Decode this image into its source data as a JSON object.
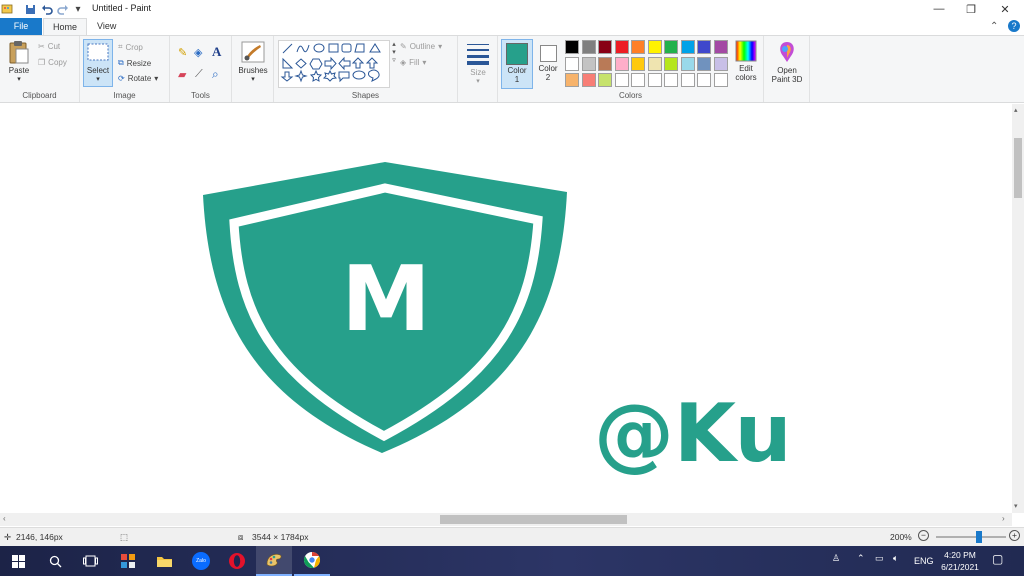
{
  "window": {
    "title": "Untitled - Paint",
    "controls": {
      "minimize": "—",
      "maximize": "❐",
      "close": "✕"
    }
  },
  "tabs": [
    {
      "label": "File"
    },
    {
      "label": "Home"
    },
    {
      "label": "View"
    }
  ],
  "ribbon": {
    "clipboard": {
      "label": "Clipboard",
      "paste": "Paste",
      "cut": "Cut",
      "copy": "Copy"
    },
    "image": {
      "label": "Image",
      "select": "Select",
      "crop": "Crop",
      "resize": "Resize",
      "rotate": "Rotate"
    },
    "tools": {
      "label": "Tools"
    },
    "brushes": {
      "label": "Brushes"
    },
    "shapes": {
      "label": "Shapes",
      "outline": "Outline",
      "fill": "Fill"
    },
    "size": {
      "label": "Size"
    },
    "colors": {
      "label": "Colors",
      "color1_label": "Color",
      "color1_num": "1",
      "color2_label": "Color",
      "color2_num": "2",
      "color1": "#26a08b",
      "color2": "#ffffff",
      "palette_row1": [
        "#000000",
        "#7f7f7f",
        "#880015",
        "#ed1c24",
        "#ff7f27",
        "#fff200",
        "#22b14c",
        "#00a2e8",
        "#3f48cc",
        "#a349a4"
      ],
      "palette_row2": [
        "#ffffff",
        "#c3c3c3",
        "#b97a57",
        "#ffaec9",
        "#ffc90e",
        "#efe4b0",
        "#b5e61d",
        "#99d9ea",
        "#7092be",
        "#c8bfe7"
      ],
      "palette_row3": [
        "#f7b36b",
        "#f77e76",
        "#c6e26c",
        "#ffffff",
        "#ffffff",
        "#ffffff",
        "#ffffff",
        "#ffffff",
        "#ffffff",
        "#ffffff"
      ],
      "edit_colors_l1": "Edit",
      "edit_colors_l2": "colors"
    },
    "paint3d": {
      "l1": "Open",
      "l2": "Paint 3D"
    }
  },
  "canvas": {
    "shield_letter": "M",
    "handle_text": "@Ku",
    "brand_color": "#26a08b"
  },
  "status": {
    "cursor_pos": "2146, 146px",
    "image_size": "3544 × 1784px",
    "zoom": "200%",
    "zoom_level": 0.62
  },
  "taskbar": {
    "language": "ENG",
    "time": "4:20 PM",
    "date": "6/21/2021",
    "zalo_label": "Zalo"
  }
}
